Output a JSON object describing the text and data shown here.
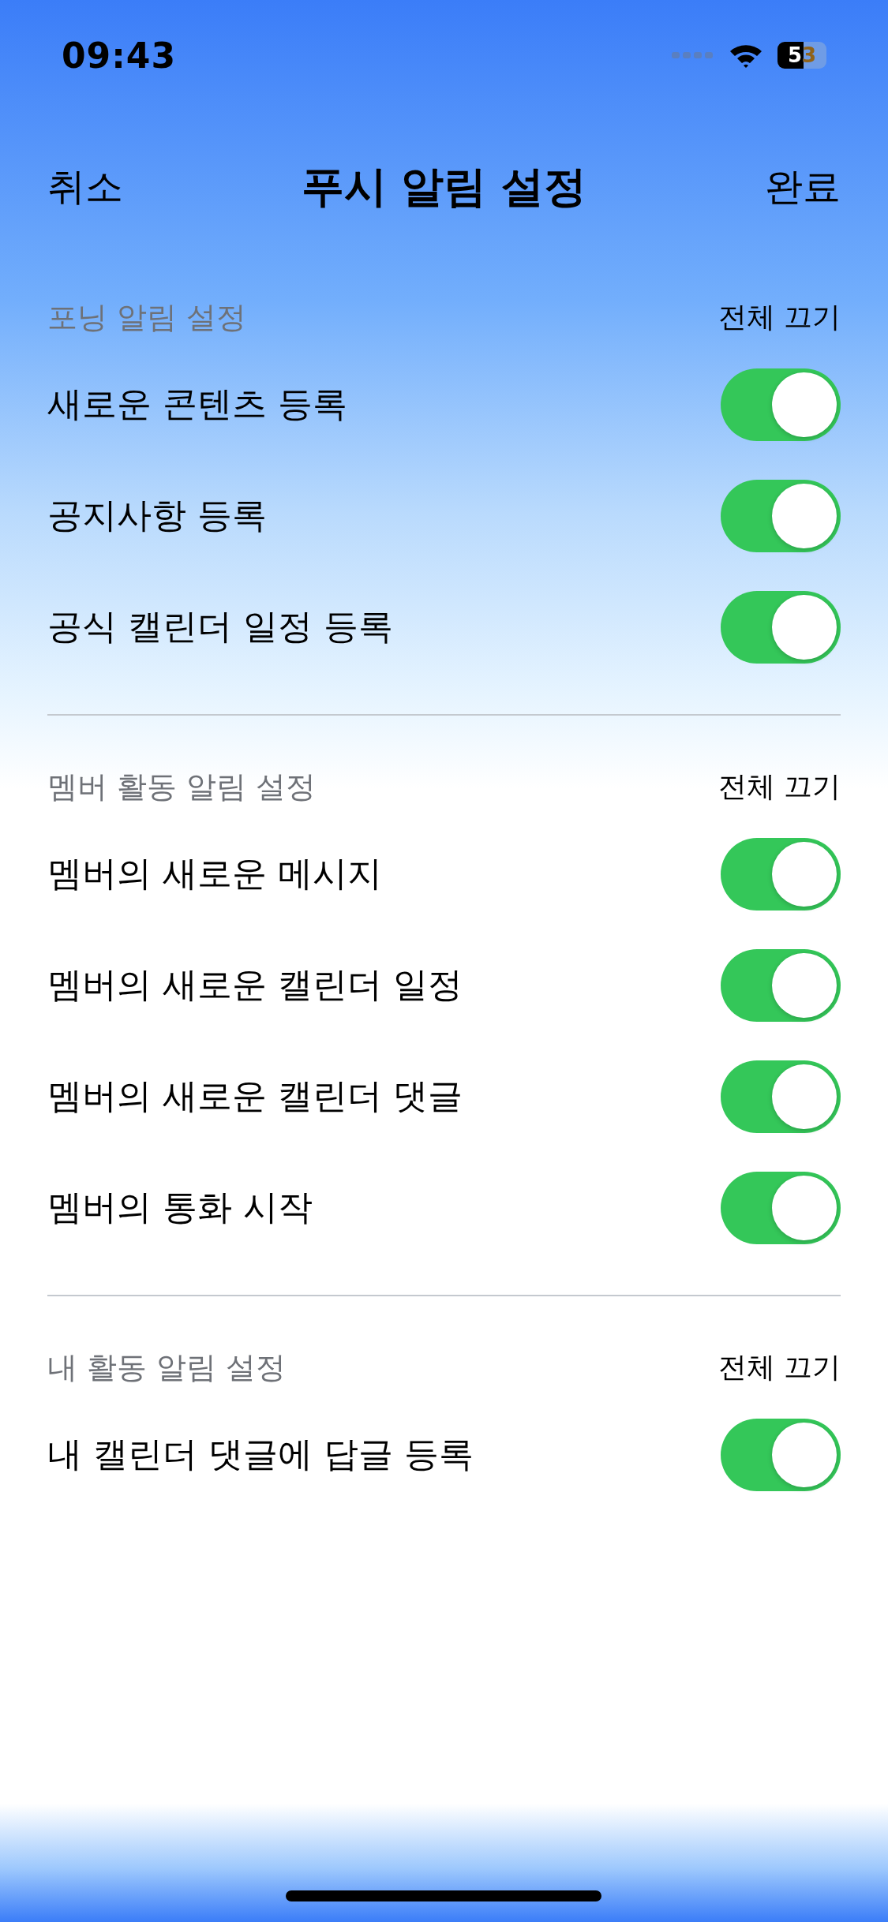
{
  "status_bar": {
    "time": "09:43",
    "battery_text": "53"
  },
  "nav": {
    "cancel": "취소",
    "title": "푸시 알림 설정",
    "done": "완료"
  },
  "sections": [
    {
      "title": "포닝 알림 설정",
      "action": "전체 끄기",
      "items": [
        {
          "label": "새로운 콘텐츠 등록",
          "on": true
        },
        {
          "label": "공지사항 등록",
          "on": true
        },
        {
          "label": "공식 캘린더 일정 등록",
          "on": true
        }
      ]
    },
    {
      "title": "멤버 활동 알림 설정",
      "action": "전체 끄기",
      "items": [
        {
          "label": "멤버의 새로운 메시지",
          "on": true
        },
        {
          "label": "멤버의 새로운 캘린더 일정",
          "on": true
        },
        {
          "label": "멤버의 새로운 캘린더 댓글",
          "on": true
        },
        {
          "label": "멤버의 통화 시작",
          "on": true
        }
      ]
    },
    {
      "title": "내 활동 알림 설정",
      "action": "전체 끄기",
      "items": [
        {
          "label": "내 캘린더 댓글에 답글 등록",
          "on": true
        }
      ]
    }
  ]
}
